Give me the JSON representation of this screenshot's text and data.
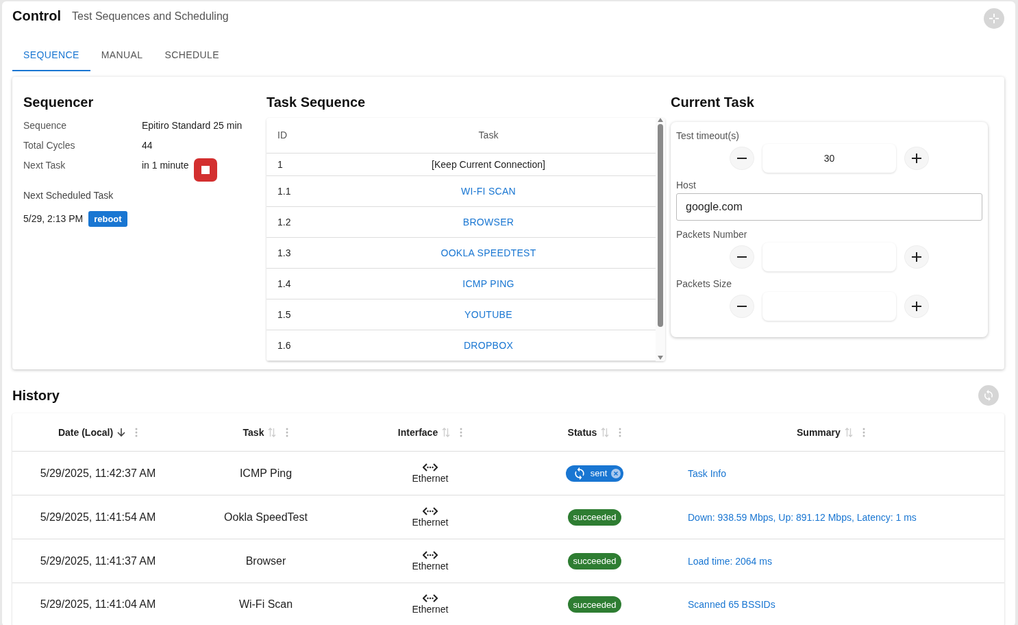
{
  "header": {
    "title": "Control",
    "subtitle": "Test Sequences and Scheduling"
  },
  "tabs": [
    {
      "label": "SEQUENCE",
      "selected": true
    },
    {
      "label": "MANUAL",
      "selected": false
    },
    {
      "label": "SCHEDULE",
      "selected": false
    }
  ],
  "sequencer": {
    "title": "Sequencer",
    "fields": [
      {
        "label": "Sequence",
        "value": "Epitiro Standard 25 min"
      },
      {
        "label": "Total Cycles",
        "value": "44"
      },
      {
        "label": "Next Task",
        "value": "in 1 minute",
        "stop_button": true
      }
    ],
    "next_scheduled_label": "Next Scheduled Task",
    "next_scheduled_time": "5/29, 2:13 PM",
    "next_scheduled_tag": "reboot"
  },
  "task_sequence": {
    "title": "Task Sequence",
    "columns": [
      "ID",
      "Task"
    ],
    "rows": [
      {
        "id": "1",
        "task": "[Keep Current Connection]",
        "kind": "text"
      },
      {
        "id": "1.1",
        "task": "WI-FI SCAN",
        "kind": "link"
      },
      {
        "id": "1.2",
        "task": "BROWSER",
        "kind": "link"
      },
      {
        "id": "1.3",
        "task": "OOKLA SPEEDTEST",
        "kind": "link"
      },
      {
        "id": "1.4",
        "task": "ICMP PING",
        "kind": "link"
      },
      {
        "id": "1.5",
        "task": "YOUTUBE",
        "kind": "link"
      },
      {
        "id": "1.6",
        "task": "DROPBOX",
        "kind": "link"
      }
    ]
  },
  "current_task": {
    "title": "Current Task",
    "fields": [
      {
        "label": "Test timeout(s)",
        "kind": "stepper",
        "value": "30"
      },
      {
        "label": "Host",
        "kind": "text",
        "value": "google.com"
      },
      {
        "label": "Packets Number",
        "kind": "stepper"
      },
      {
        "label": "Packets Size",
        "kind": "stepper"
      }
    ]
  },
  "history": {
    "title": "History",
    "columns": [
      {
        "label": "Date (Local)",
        "sorted": true
      },
      {
        "label": "Task",
        "sorted": false
      },
      {
        "label": "Interface",
        "sorted": false
      },
      {
        "label": "Status",
        "sorted": false
      },
      {
        "label": "Summary",
        "sorted": false
      }
    ],
    "rows": [
      {
        "date": "5/29/2025, 11:42:37 AM",
        "task": "ICMP Ping",
        "interface": "Ethernet",
        "status": {
          "kind": "sent",
          "label": "sent"
        },
        "summary": "Task Info"
      },
      {
        "date": "5/29/2025, 11:41:54 AM",
        "task": "Ookla SpeedTest",
        "interface": "Ethernet",
        "status": {
          "kind": "succeeded",
          "label": "succeeded"
        },
        "summary": "Down: 938.59 Mbps, Up: 891.12 Mbps, Latency: 1 ms"
      },
      {
        "date": "5/29/2025, 11:41:37 AM",
        "task": "Browser",
        "interface": "Ethernet",
        "status": {
          "kind": "succeeded",
          "label": "succeeded"
        },
        "summary": "Load time: 2064 ms"
      },
      {
        "date": "5/29/2025, 11:41:04 AM",
        "task": "Wi-Fi Scan",
        "interface": "Ethernet",
        "status": {
          "kind": "succeeded",
          "label": "succeeded"
        },
        "summary": "Scanned 65 BSSIDs"
      }
    ]
  }
}
